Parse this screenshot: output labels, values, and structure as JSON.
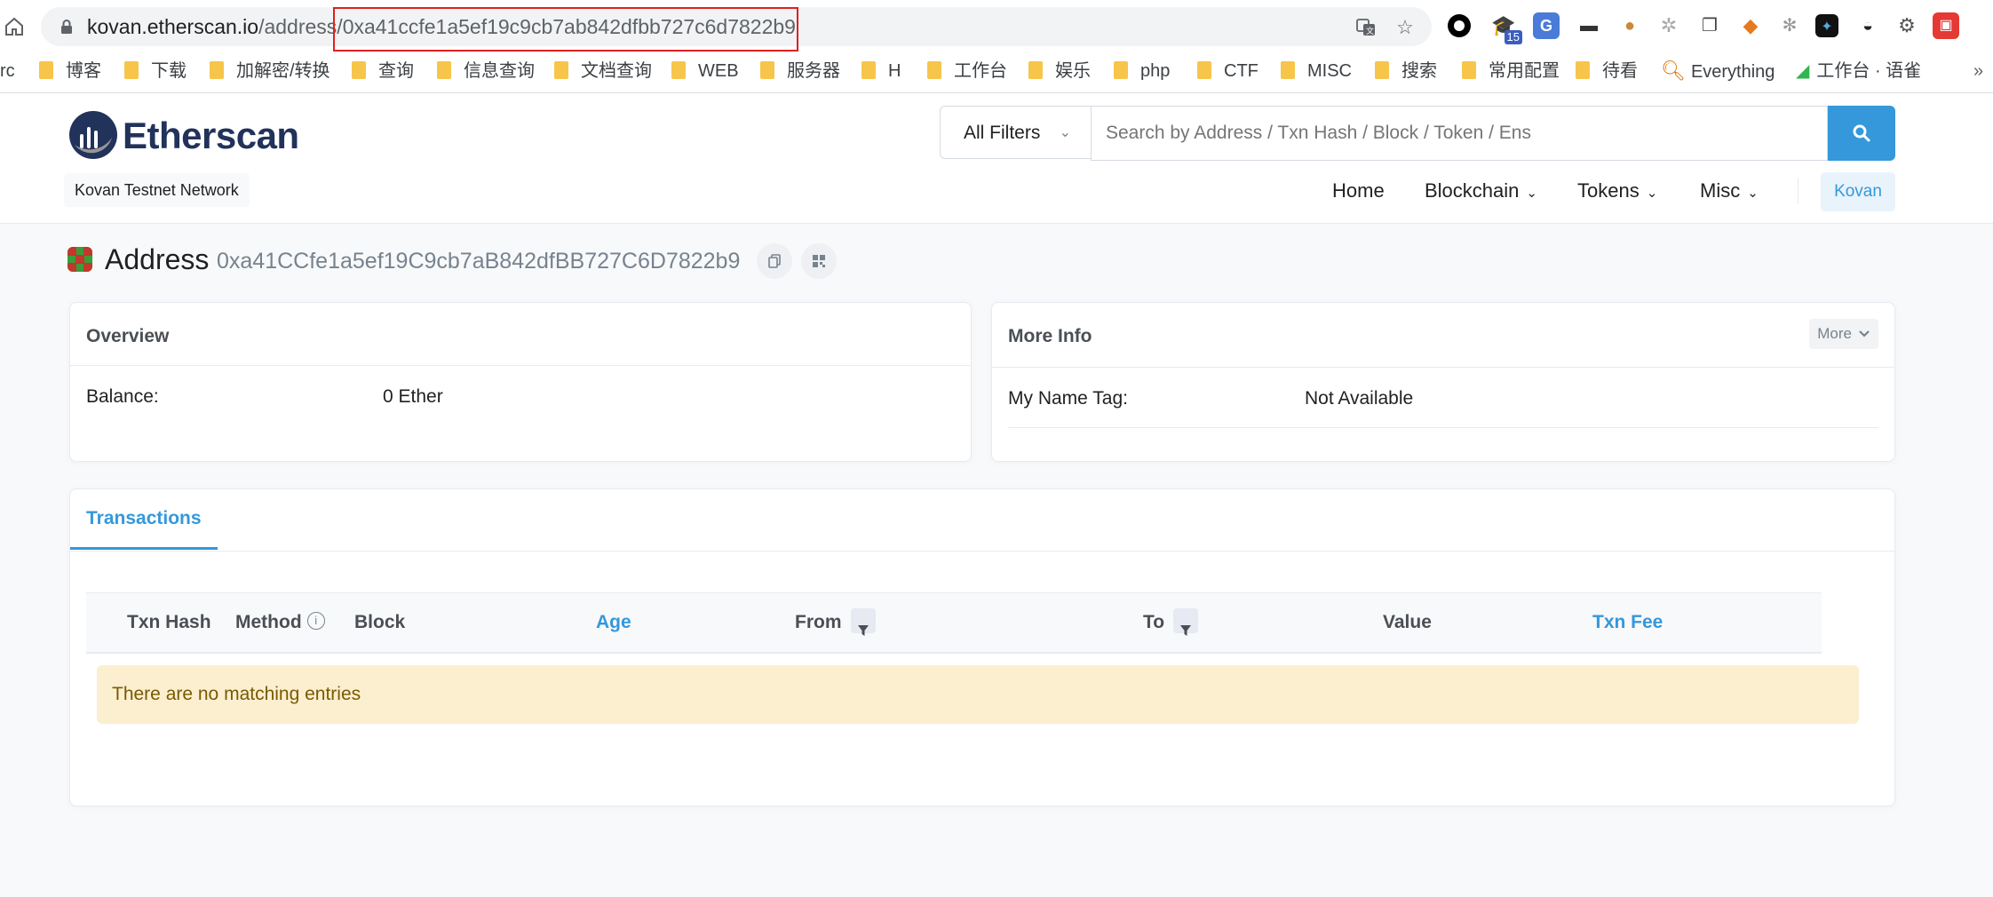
{
  "browser": {
    "url_host": "kovan.etherscan.io",
    "url_path": "/address/",
    "url_hash": "0xa41ccfe1a5ef19c9cb7ab842dfbb727c6d7822b9",
    "extension_badge": "15",
    "bookmarks": [
      {
        "label": "rc",
        "folder": false
      },
      {
        "label": "博客",
        "folder": true
      },
      {
        "label": "下载",
        "folder": true
      },
      {
        "label": "加解密/转换",
        "folder": true
      },
      {
        "label": "查询",
        "folder": true
      },
      {
        "label": "信息查询",
        "folder": true
      },
      {
        "label": "文档查询",
        "folder": true
      },
      {
        "label": "WEB",
        "folder": true
      },
      {
        "label": "服务器",
        "folder": true
      },
      {
        "label": "H",
        "folder": true
      },
      {
        "label": "工作台",
        "folder": true
      },
      {
        "label": "娱乐",
        "folder": true
      },
      {
        "label": "php",
        "folder": true
      },
      {
        "label": "CTF",
        "folder": true
      },
      {
        "label": "MISC",
        "folder": true
      },
      {
        "label": "搜索",
        "folder": true
      },
      {
        "label": "常用配置",
        "folder": true
      },
      {
        "label": "待看",
        "folder": true
      },
      {
        "label": "Everything",
        "folder": false
      },
      {
        "label": "工作台 · 语雀",
        "folder": false
      }
    ]
  },
  "header": {
    "logo_text": "Etherscan",
    "network": "Kovan Testnet Network",
    "filter_label": "All Filters",
    "search_placeholder": "Search by Address / Txn Hash / Block / Token / Ens",
    "nav": [
      "Home",
      "Blockchain",
      "Tokens",
      "Misc"
    ],
    "network_button": "Kovan"
  },
  "address": {
    "title": "Address",
    "hash": "0xa41CCfe1a5ef19C9cb7aB842dfBB727C6D7822b9"
  },
  "overview": {
    "title": "Overview",
    "balance_label": "Balance:",
    "balance_value": "0 Ether"
  },
  "more_info": {
    "title": "More Info",
    "more_button": "More",
    "name_tag_label": "My Name Tag:",
    "name_tag_value": "Not Available"
  },
  "transactions": {
    "tab_label": "Transactions",
    "columns": [
      "Txn Hash",
      "Method",
      "Block",
      "Age",
      "From",
      "To",
      "Value",
      "Txn Fee"
    ],
    "empty_message": "There are no matching entries"
  },
  "colors": {
    "accent": "#3498db",
    "brand": "#21325b",
    "empty_bg": "#fbefd0",
    "highlight_box": "#e02020"
  },
  "icons": [
    "home-icon",
    "lock-icon",
    "translate-icon",
    "star-icon",
    "search-icon",
    "chevron-down-icon",
    "copy-icon",
    "qr-code-icon",
    "filter-icon",
    "info-icon",
    "folder-icon"
  ]
}
